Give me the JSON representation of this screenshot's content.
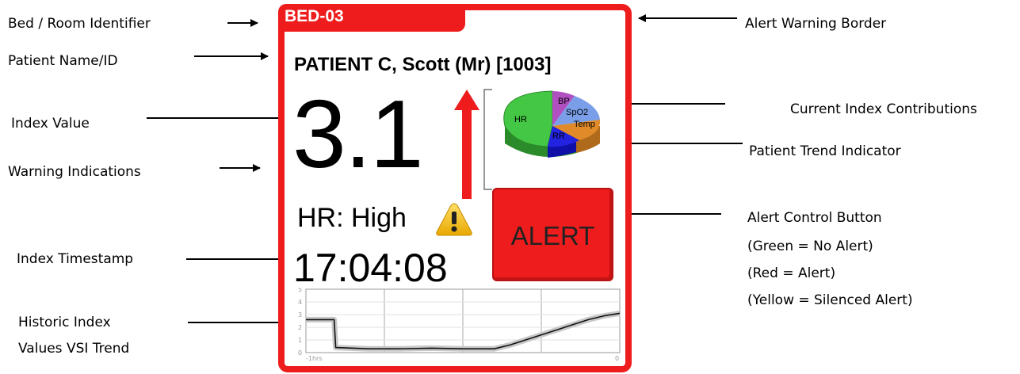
{
  "annotations": {
    "bed_room": "Bed / Room Identifier",
    "patient_name": "Patient Name/ID",
    "index_value": "Index Value",
    "warning_indications": "Warning Indications",
    "index_timestamp": "Index Timestamp",
    "historic_line1": "Historic Index",
    "historic_line2": "Values VSI Trend",
    "alert_border": "Alert Warning Border",
    "index_contributions": "Current Index Contributions",
    "trend_indicator": "Patient Trend Indicator",
    "alert_button_line1": "Alert Control Button",
    "alert_button_line2": "(Green = No Alert)",
    "alert_button_line3": "(Red = Alert)",
    "alert_button_line4": "(Yellow = Silenced Alert)"
  },
  "monitor": {
    "bed": "BED-03",
    "patient": "PATIENT C, Scott (Mr) [1003]",
    "index_value": "3.1",
    "trend": "up",
    "warning_text": "HR: High",
    "warning_icon": "warning-triangle-icon",
    "timestamp": "17:04:08",
    "alert_button_label": "ALERT",
    "alert_color": "#ee1c1c",
    "contributions": [
      {
        "label": "HR",
        "color": "#44c744"
      },
      {
        "label": "BP",
        "color": "#b050c0"
      },
      {
        "label": "SpO2",
        "color": "#7a9ee8"
      },
      {
        "label": "Temp",
        "color": "#e08a2a"
      },
      {
        "label": "RR",
        "color": "#1c1cd8"
      }
    ]
  },
  "history": {
    "y_ticks": [
      "5",
      "4",
      "3",
      "2",
      "1",
      "0"
    ],
    "x_start_label": "-1hrs",
    "x_end_label": "0"
  },
  "chart_data": {
    "type": "line",
    "ylim": [
      0,
      5
    ],
    "xlabels": [
      "-1hrs",
      "0"
    ],
    "x": [
      0,
      0.04,
      0.09,
      0.095,
      0.2,
      0.3,
      0.4,
      0.5,
      0.55,
      0.6,
      0.65,
      0.7,
      0.75,
      0.8,
      0.85,
      0.9,
      0.95,
      1.0
    ],
    "y": [
      2.6,
      2.6,
      2.6,
      0.4,
      0.3,
      0.3,
      0.35,
      0.3,
      0.3,
      0.3,
      0.6,
      1.0,
      1.4,
      1.8,
      2.2,
      2.6,
      2.9,
      3.1
    ]
  }
}
